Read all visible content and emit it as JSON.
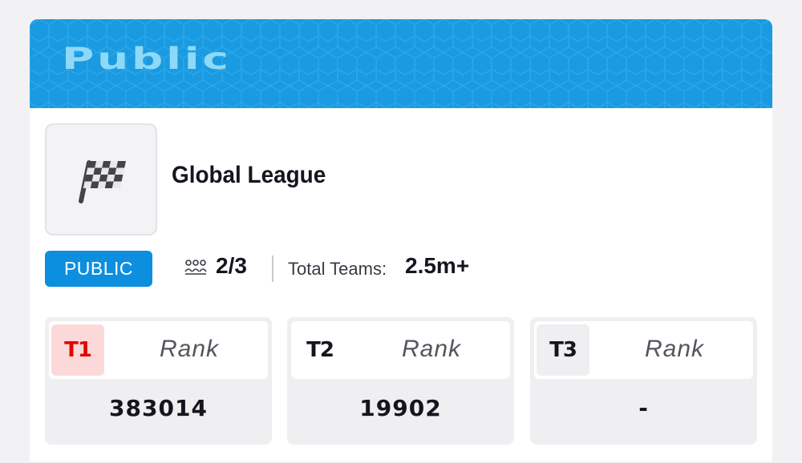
{
  "banner": {
    "title": "Public",
    "color": "#1a9ae0"
  },
  "league": {
    "name": "Global League",
    "icon": "checkered-flag-icon"
  },
  "badge": {
    "label": "PUBLIC",
    "color": "#0d8fe0"
  },
  "stats": {
    "members_icon": "members-icon",
    "members": "2/3",
    "total_teams_label": "Total Teams:",
    "total_teams_value": "2.5m+"
  },
  "teams": [
    {
      "tag": "T1",
      "rank_label": "Rank",
      "rank_value": "383014",
      "tag_color": "#e10600"
    },
    {
      "tag": "T2",
      "rank_label": "Rank",
      "rank_value": "19902"
    },
    {
      "tag": "T3",
      "rank_label": "Rank",
      "rank_value": "-"
    }
  ]
}
